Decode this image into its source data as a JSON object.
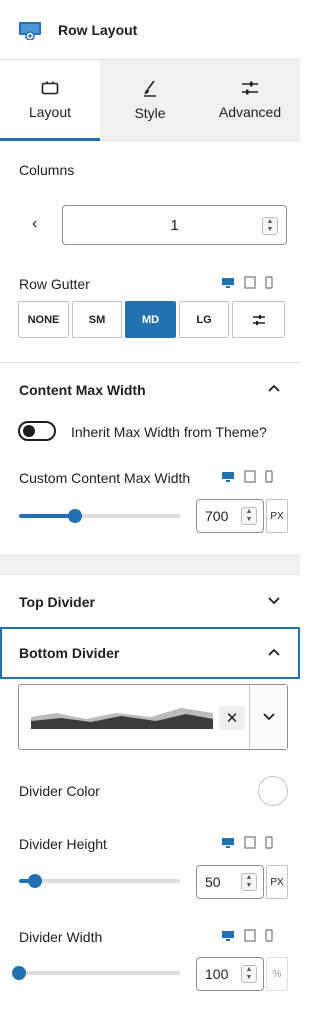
{
  "header": {
    "title": "Row Layout",
    "icon": "row-layout-icon"
  },
  "tabs": [
    {
      "label": "Layout",
      "icon": "layout-icon",
      "active": true
    },
    {
      "label": "Style",
      "icon": "brush-icon",
      "active": false
    },
    {
      "label": "Advanced",
      "icon": "sliders-icon",
      "active": false
    }
  ],
  "columns": {
    "label": "Columns",
    "value": "1",
    "prev_icon": "chevron-left-icon"
  },
  "row_gutter": {
    "label": "Row Gutter",
    "options": [
      "NONE",
      "SM",
      "MD",
      "LG"
    ],
    "selected": "MD",
    "custom_icon": "sliders-icon"
  },
  "content_max_width": {
    "label": "Content Max Width",
    "toggle_label": "Inherit Max Width from Theme?",
    "toggle_on": false,
    "custom_label": "Custom Content Max Width",
    "value": "700",
    "unit": "PX",
    "slider_fraction": 0.35
  },
  "top_divider": {
    "label": "Top Divider"
  },
  "bottom_divider": {
    "label": "Bottom Divider",
    "clear_symbol": "✕",
    "color_label": "Divider Color",
    "height_label": "Divider Height",
    "height_value": "50",
    "height_unit": "PX",
    "height_fraction": 0.1,
    "width_label": "Divider Width",
    "width_value": "100",
    "width_unit": "%",
    "width_fraction": 0.0
  },
  "colors": {
    "accent": "#2271b1",
    "dark": "#1e1e1e",
    "border": "#e0e0e0"
  }
}
